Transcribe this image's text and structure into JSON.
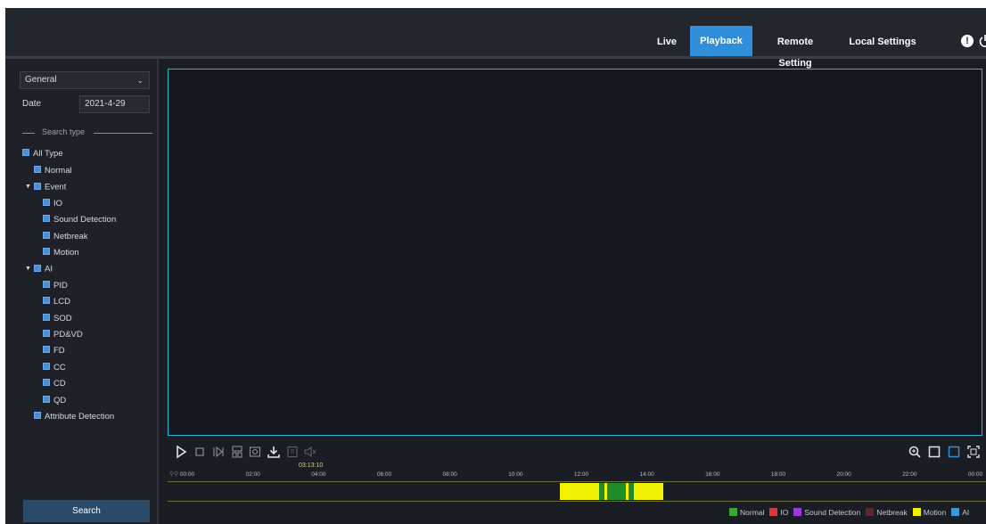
{
  "nav": {
    "live": "Live",
    "playback": "Playback",
    "remote_setting": "Remote Setting",
    "local_settings": "Local Settings"
  },
  "header_icons": [
    "alert-icon",
    "power-icon"
  ],
  "sidebar": {
    "search_mode": "General",
    "date_label": "Date",
    "date_value": "2021-4-29",
    "search_type_label": "Search type",
    "tree": {
      "all_type": "All Type",
      "normal": "Normal",
      "event": "Event",
      "io": "IO",
      "sound_detection": "Sound Detection",
      "netbreak": "Netbreak",
      "motion": "Motion",
      "ai": "AI",
      "pid": "PID",
      "lcd": "LCD",
      "sod": "SOD",
      "pdvd": "PD&VD",
      "fd": "FD",
      "cc": "CC",
      "cd": "CD",
      "qd": "QD",
      "attribute_detection": "Attribute Detection"
    },
    "search_button": "Search"
  },
  "controls": {
    "left": [
      "play-icon",
      "stop-icon",
      "frame-step-icon",
      "split-icon",
      "snapshot-icon",
      "download-icon",
      "clip-icon",
      "mute-icon"
    ],
    "right": [
      "zoom-icon",
      "window-icon",
      "fullscreen-window-icon",
      "fit-screen-icon"
    ]
  },
  "timeline": {
    "cursor_time": "03:13:10",
    "tick_labels": [
      "00:00",
      "02:00",
      "04:00",
      "06:00",
      "08:00",
      "10:00",
      "12:00",
      "14:00",
      "16:00",
      "18:00",
      "20:00",
      "22:00",
      "00:00"
    ],
    "records": [
      {
        "type": "Motion",
        "start_hour": 11.35,
        "end_hour": 12.55
      },
      {
        "type": "Normal",
        "start_hour": 12.55,
        "end_hour": 12.7
      },
      {
        "type": "Motion",
        "start_hour": 12.7,
        "end_hour": 12.78
      },
      {
        "type": "Normal",
        "start_hour": 12.78,
        "end_hour": 13.35
      },
      {
        "type": "Motion",
        "start_hour": 13.35,
        "end_hour": 13.45
      },
      {
        "type": "Normal",
        "start_hour": 13.45,
        "end_hour": 13.6
      },
      {
        "type": "Motion",
        "start_hour": 13.6,
        "end_hour": 14.5
      }
    ]
  },
  "legend": [
    {
      "label": "Normal",
      "color": "#3aa63a"
    },
    {
      "label": "IO",
      "color": "#d83a3a"
    },
    {
      "label": "Sound Detection",
      "color": "#9a3ad8"
    },
    {
      "label": "Netbreak",
      "color": "#5a2a2a"
    },
    {
      "label": "Motion",
      "color": "#f0f000"
    },
    {
      "label": "AI",
      "color": "#2f9be0"
    }
  ],
  "colors": {
    "accent": "#2f8fdb",
    "video_border": "#26b8d6",
    "motion": "#f0f000",
    "normal": "#1f8c2a"
  }
}
